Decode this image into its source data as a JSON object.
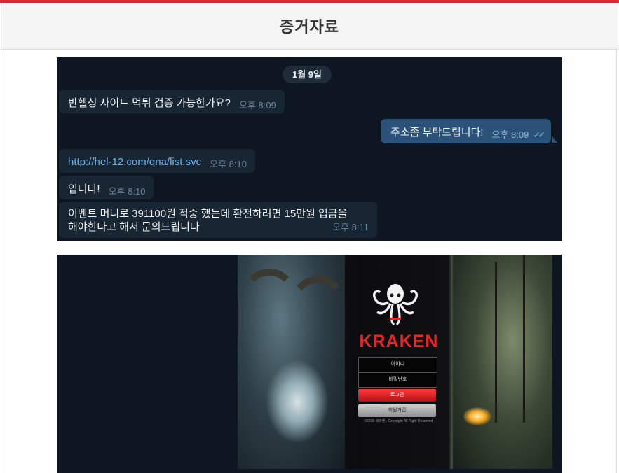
{
  "header": {
    "title": "증거자료"
  },
  "chat": {
    "date": "1월 9일",
    "messages": [
      {
        "text": "반헬싱 사이트 먹튀 검증 가능한가요?",
        "time": "오후 8:09"
      },
      {
        "text": "주소좀 부탁드립니다!",
        "time": "오후 8:09",
        "check": "✓✓"
      },
      {
        "text": "http://hel-12.com/qna/list.svc",
        "time": "오후 8:10"
      },
      {
        "text": "입니다!",
        "time": "오후 8:10"
      },
      {
        "text_line1": "이벤트 머니로 391100원 적중 했는데 환전하려면 15만원 입금을",
        "text_line2": "해야한다고 해서 문의드립니다",
        "time": "오후 8:11"
      }
    ]
  },
  "site": {
    "brand": "KRAKEN",
    "id_field": "아이디",
    "pw_field": "비밀번호",
    "login_button": "로그인",
    "join_button": "회원가입",
    "copyright": "©2018 크라켄 . Copyright All Right Reserved."
  },
  "colors": {
    "accent": "#e0262f",
    "chat_bg": "#0e1621",
    "bubble_in": "#182533",
    "bubble_out": "#2b5278",
    "link": "#6ab2f2",
    "brand_red": "#e4262c"
  }
}
